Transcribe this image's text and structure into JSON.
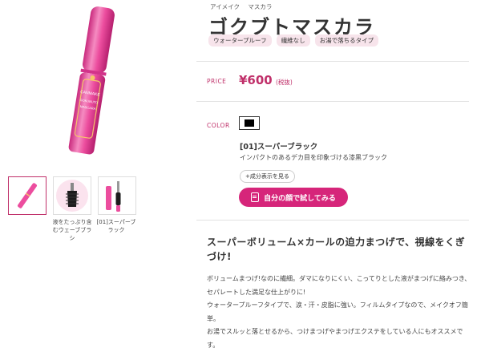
{
  "breadcrumb": [
    "アイメイク",
    "マスカラ"
  ],
  "product": {
    "title": "ゴクブトマスカラ",
    "tags": [
      "ウォータープルーフ",
      "繊維なし",
      "お湯で落ちるタイプ"
    ],
    "price_label": "PRICE",
    "price": "¥600",
    "tax_note": "(税抜)",
    "color_label": "COLOR",
    "shade_name": "[01]スーパーブラック",
    "shade_description": "インパクトのあるデカ目を印象づける漆黒ブラック",
    "ingredients_button": "+成分表示を見る",
    "tryon_button": "自分の顔で試してみる",
    "package_text": [
      "CANMAKE",
      "GOKUBUTO",
      "MASCARA"
    ]
  },
  "thumbnails": [
    {
      "caption": ""
    },
    {
      "caption": "液をたっぷり含むウェーブブラシ"
    },
    {
      "caption": "[01]スーパーブラック"
    }
  ],
  "description": {
    "headline": "スーパーボリューム×カールの迫力まつげで、視線をくぎづけ!",
    "paragraphs": [
      "ボリュームまつげ!なのに繊細。ダマになりにくい、こってりとした液がまつげに絡みつき、セパレートした満足な仕上がりに!",
      "ウォータープルーフタイプで、涙・汗・皮脂に強い。フィルムタイプなので、メイクオフ簡単。",
      "お湯でスルッと落とせるから、つけまつげやまつげエクステをしている人にもオススメです。"
    ]
  },
  "colors": {
    "accent": "#d6257a",
    "label": "#c0306a",
    "tag_bg": "#f7e4eb",
    "tube_pink": "#ec4d9e",
    "swatch": "#000000"
  }
}
